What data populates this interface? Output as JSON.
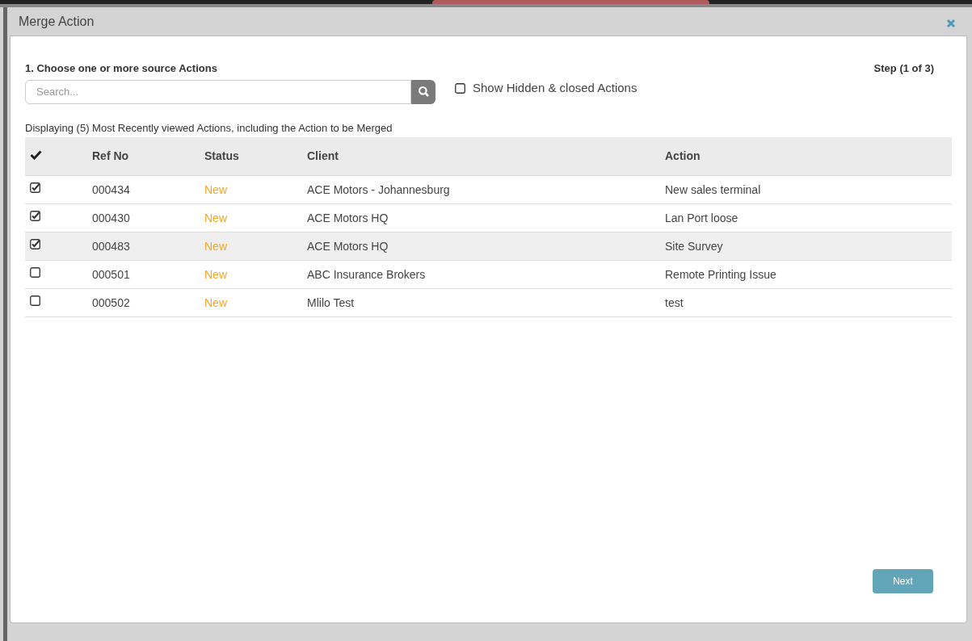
{
  "window": {
    "title": "Merge Action"
  },
  "step_heading": "1. Choose one or more source Actions",
  "step_indicator": "Step (1 of 3)",
  "search": {
    "placeholder": "Search..."
  },
  "show_hidden": {
    "label": "Show Hidden & closed Actions",
    "checked": false
  },
  "caption": "Displaying (5) Most Recently viewed Actions, including the Action to be Merged",
  "table": {
    "columns": [
      "Ref No",
      "Status",
      "Client",
      "Action"
    ],
    "rows": [
      {
        "checked": true,
        "highlighted": false,
        "ref_no": "000434",
        "status": "New",
        "client": "ACE Motors - Johannesburg",
        "action": "New sales terminal"
      },
      {
        "checked": true,
        "highlighted": false,
        "ref_no": "000430",
        "status": "New",
        "client": "ACE Motors HQ",
        "action": "Lan Port loose"
      },
      {
        "checked": true,
        "highlighted": true,
        "ref_no": "000483",
        "status": "New",
        "client": "ACE Motors HQ",
        "action": "Site Survey"
      },
      {
        "checked": false,
        "highlighted": false,
        "ref_no": "000501",
        "status": "New",
        "client": "ABC Insurance Brokers",
        "action": "Remote Printing Issue"
      },
      {
        "checked": false,
        "highlighted": false,
        "ref_no": "000502",
        "status": "New",
        "client": "Mlilo Test",
        "action": "test"
      }
    ]
  },
  "next_button": "Next"
}
